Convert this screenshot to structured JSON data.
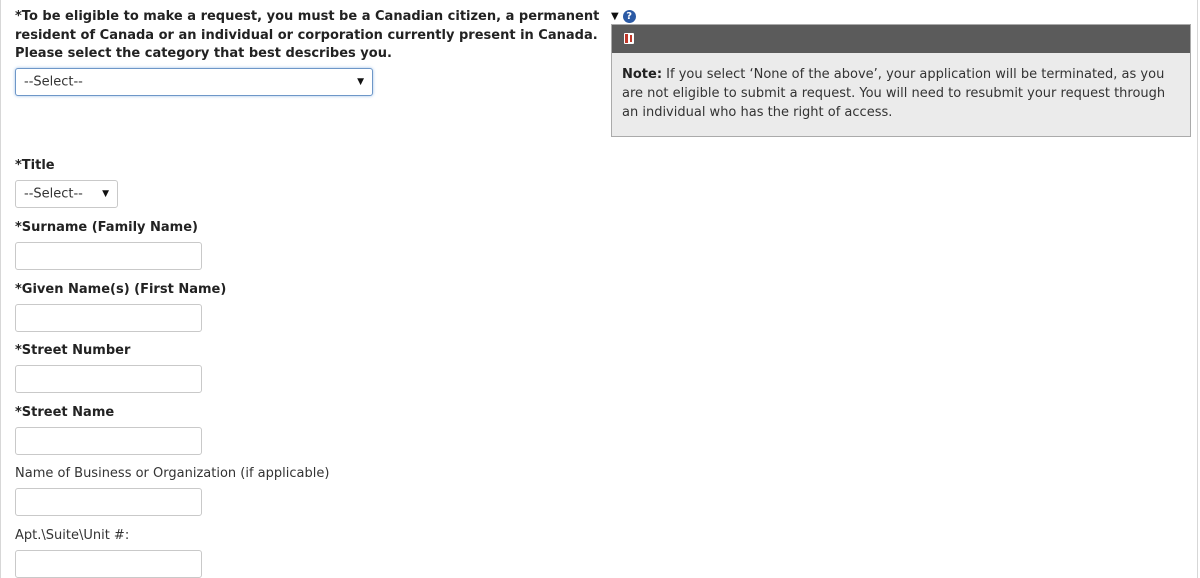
{
  "eligibility": {
    "label": "*To be eligible to make a request, you must be a Canadian citizen, a permanent resident of Canada or an individual or corporation currently present in Canada. Please select the category that best describes you.",
    "selected": "--Select--"
  },
  "help": {
    "toggle_glyph": "▼",
    "icon_glyph": "?",
    "note_label": "Note:",
    "note_text": " If you select ‘None of the above’, your application will be terminated, as you are not eligible to submit a request. You will need to resubmit your request through an individual who has the right of access."
  },
  "fields": {
    "title": {
      "label": "*Title",
      "selected": "--Select--"
    },
    "surname": {
      "label": "*Surname (Family Name)",
      "value": ""
    },
    "given_name": {
      "label": "*Given Name(s) (First Name)",
      "value": ""
    },
    "street_number": {
      "label": "*Street Number",
      "value": ""
    },
    "street_name": {
      "label": "*Street Name",
      "value": ""
    },
    "business": {
      "label": "Name of Business or Organization (if applicable)",
      "value": ""
    },
    "apt": {
      "label": "Apt.\\Suite\\Unit #:",
      "value": ""
    }
  },
  "select_arrow": "▼",
  "colors": {
    "focus_border": "#6e97c8",
    "panel_bar": "#5b5b5b",
    "panel_bg": "#ebebeb",
    "help_icon": "#2b5aa5"
  }
}
